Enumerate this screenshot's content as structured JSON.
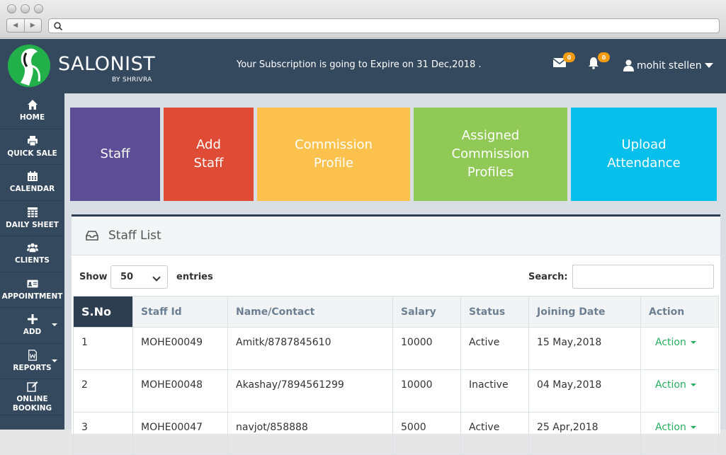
{
  "header": {
    "brand": "SALONIST",
    "brand_sub": "BY SHRIVRA",
    "notice": "Your Subscription is going to Expire on 31 Dec,2018 .",
    "mail_count": "0",
    "bell_count": "0",
    "user_name": "mohit stellen"
  },
  "sidebar": {
    "items": [
      {
        "label": "HOME",
        "icon": "home-icon"
      },
      {
        "label": "QUICK SALE",
        "icon": "printer-icon"
      },
      {
        "label": "CALENDAR",
        "icon": "calendar-icon"
      },
      {
        "label": "DAILY SHEET",
        "icon": "table-icon"
      },
      {
        "label": "CLIENTS",
        "icon": "users-icon"
      },
      {
        "label": "APPOINTMENT",
        "icon": "id-card-icon"
      },
      {
        "label": "ADD",
        "icon": "plus-icon"
      },
      {
        "label": "REPORTS",
        "icon": "document-icon"
      },
      {
        "label": "ONLINE BOOKING",
        "icon": "edit-icon"
      }
    ]
  },
  "tiles": [
    {
      "label": "Staff",
      "color": "#5b4e96"
    },
    {
      "label": "Add Staff",
      "color": "#e04b35"
    },
    {
      "label": "Commission Profile",
      "color": "#fcc24d"
    },
    {
      "label": "Assigned Commission Profiles",
      "color": "#91c957"
    },
    {
      "label": "Upload Attendance",
      "color": "#06bfeb"
    }
  ],
  "panel": {
    "title": "Staff List",
    "show_label": "Show",
    "page_size": "50",
    "entries_label": "entries",
    "search_label": "Search:",
    "search_value": ""
  },
  "table": {
    "columns": [
      "S.No",
      "Staff Id",
      "Name/Contact",
      "Salary",
      "Status",
      "Joining Date",
      "Action"
    ],
    "rows": [
      [
        "1",
        "MOHE00049",
        "Amitk/8787845610",
        "10000",
        "Active",
        "15 May,2018",
        "Action"
      ],
      [
        "2",
        "MOHE00048",
        "Akashay/7894561299",
        "10000",
        "Inactive",
        "04 May,2018",
        "Action"
      ],
      [
        "3",
        "MOHE00047",
        "navjot/858888",
        "5000",
        "Active",
        "25 Apr,2018",
        "Action"
      ]
    ]
  }
}
